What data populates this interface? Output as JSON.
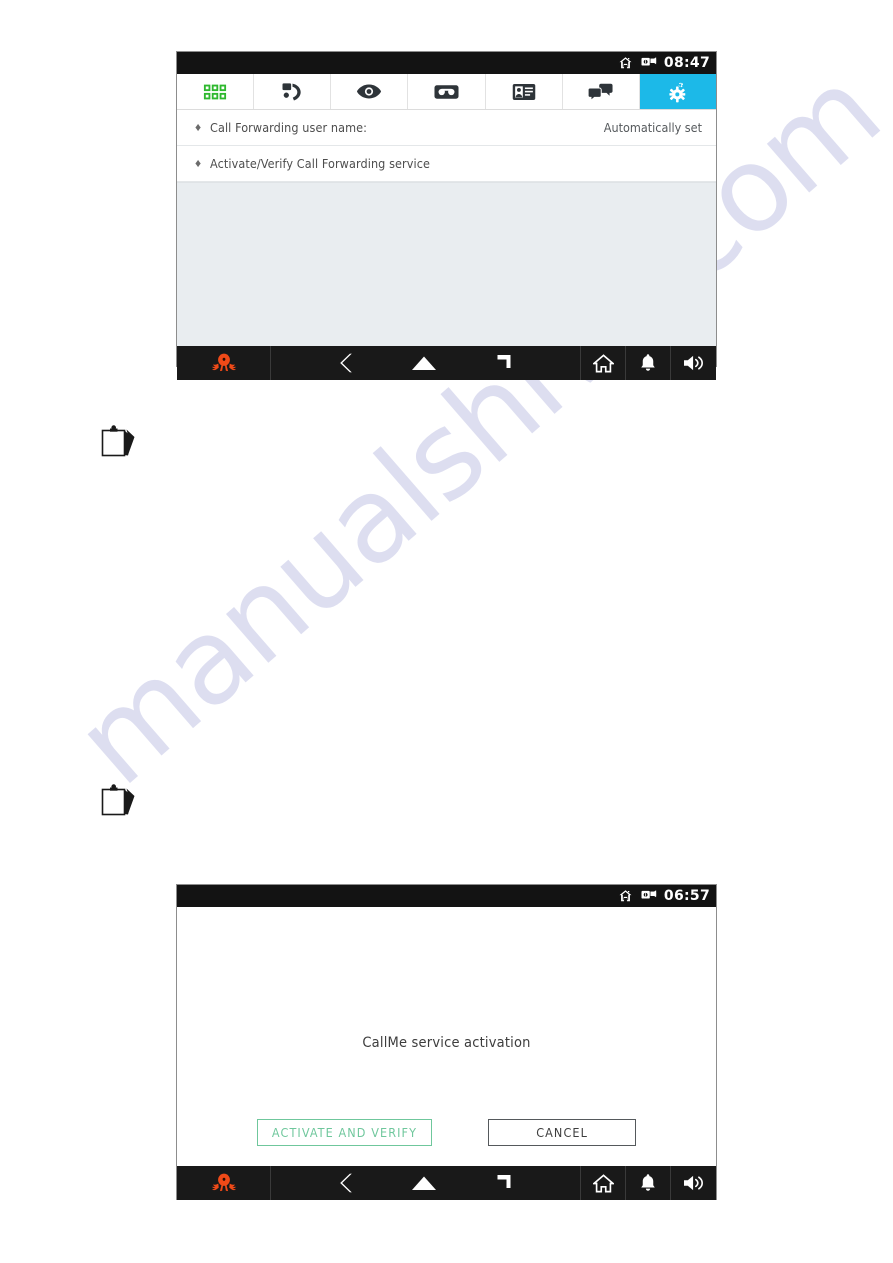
{
  "document": {
    "watermark_text": "manualshive.com",
    "watermark_color": "#c9cbe8"
  },
  "colors": {
    "accent_tab": "#1cb9e8",
    "primary_button": "#6fc79c",
    "secondary_button": "#55595c",
    "status_bar": "#131313",
    "nav_bar": "#191919",
    "logo": "#f04a18",
    "app_grid_green": "#2eb82e",
    "filler": "#e9edf0"
  },
  "screens": [
    {
      "id": "call-forwarding-settings",
      "statusbar": {
        "icons": [
          "home-icon",
          "multi-window-icon"
        ],
        "time": "08:47"
      },
      "tabs": [
        {
          "id": "apps",
          "icon": "app-grid-icon",
          "label": "Apps",
          "active": false
        },
        {
          "id": "calls",
          "icon": "phone-handset-icon",
          "label": "Calls",
          "active": false
        },
        {
          "id": "view",
          "icon": "eye-icon",
          "label": "View",
          "active": false
        },
        {
          "id": "voicemail",
          "icon": "voicemail-icon",
          "label": "Voicemail",
          "active": false
        },
        {
          "id": "contacts",
          "icon": "contact-card-icon",
          "label": "Contacts",
          "active": false
        },
        {
          "id": "messages",
          "icon": "chat-bubbles-icon",
          "label": "Messages",
          "active": false
        },
        {
          "id": "settings",
          "icon": "gear-icon",
          "label": "Settings",
          "active": true
        }
      ],
      "rows": [
        {
          "bullet": "♦",
          "label": "Call Forwarding user name:",
          "value": "Automatically set"
        },
        {
          "bullet": "♦",
          "label": "Activate/Verify Call Forwarding service",
          "value": ""
        }
      ]
    },
    {
      "id": "callme-activation-dialog",
      "statusbar": {
        "icons": [
          "home-icon",
          "multi-window-icon"
        ],
        "time": "06:57"
      },
      "dialog": {
        "message": "CallMe service activation",
        "buttons": [
          {
            "id": "activate-and-verify",
            "label": "ACTIVATE AND VERIFY",
            "style": "primary"
          },
          {
            "id": "cancel",
            "label": "CANCEL",
            "style": "secondary"
          }
        ]
      }
    }
  ],
  "navbar": {
    "logo_icon": "octopus-logo-icon",
    "items": [
      {
        "id": "back",
        "icon": "back-chevron-icon"
      },
      {
        "id": "home",
        "icon": "home-pentagon-icon"
      },
      {
        "id": "recent-apps",
        "icon": "recent-apps-arrow-icon"
      }
    ],
    "right_items": [
      {
        "id": "home-shortcut",
        "icon": "home-icon"
      },
      {
        "id": "notifications",
        "icon": "bell-icon"
      },
      {
        "id": "volume",
        "icon": "speaker-icon"
      }
    ]
  }
}
